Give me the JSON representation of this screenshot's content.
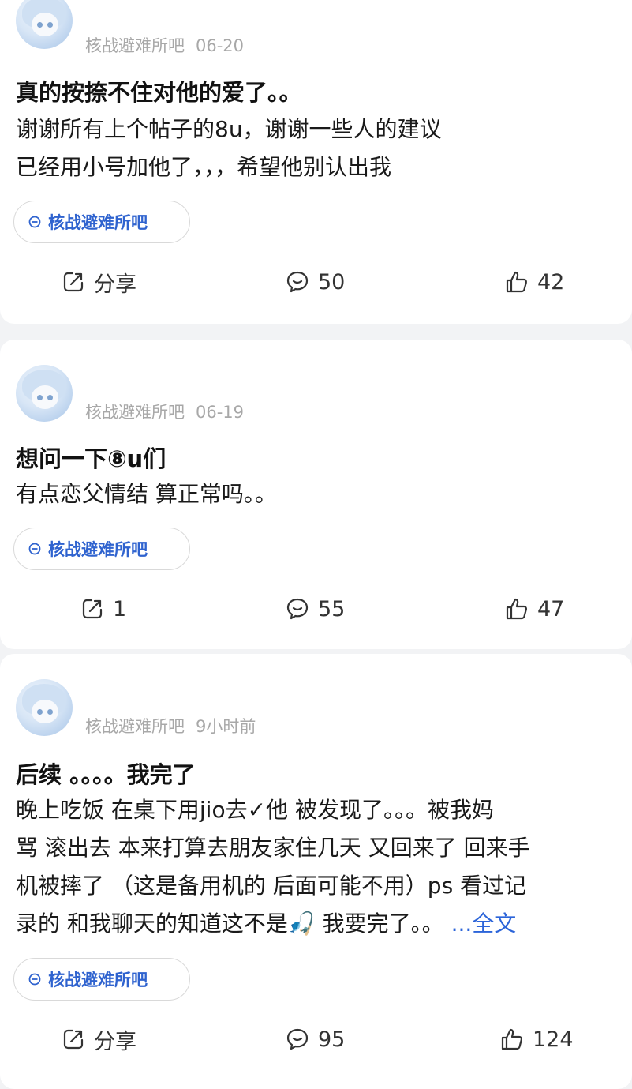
{
  "posts": [
    {
      "author": "核战避难所吧",
      "date": "06-20",
      "title": "真的按捺不住对他的爱了。。",
      "body_lines": [
        "谢谢所有上个帖子的8u，谢谢一些人的建议",
        "已经用小号加他了，，，希望他别认出我"
      ],
      "more": "",
      "forum": "核战避难所吧",
      "share": "分享",
      "comments": "50",
      "likes": "42"
    },
    {
      "author": "核战避难所吧",
      "date": "06-19",
      "title": "想问一下⑧u们",
      "body_lines": [
        "有点恋父情结 算正常吗。。"
      ],
      "more": "",
      "forum": "核战避难所吧",
      "share": "1",
      "comments": "55",
      "likes": "47"
    },
    {
      "author": "核战避难所吧",
      "date": "9小时前",
      "title": "后续 。。。。我完了",
      "body_lines": [
        "晚上吃饭 在桌下用jio去✓他 被发现了。。。被我妈",
        "骂 滚出去 本来打算去朋友家住几天 又回来了 回来手",
        "机被摔了 （这是备用机的 后面可能不用）ps 看过记",
        "录的 和我聊天的知道这不是🎣 我要完了。。"
      ],
      "more": "...全文",
      "forum": "核战避难所吧",
      "share": "分享",
      "comments": "95",
      "likes": "124"
    }
  ],
  "colors": {
    "accent": "#2f63cf",
    "link": "#2b64d9",
    "meta": "#a8a8a8",
    "background": "#f2f3f5"
  },
  "icons": {
    "share": "share-icon",
    "comment": "comment-icon",
    "like": "thumbs-up-icon",
    "forum": "forum-icon"
  }
}
